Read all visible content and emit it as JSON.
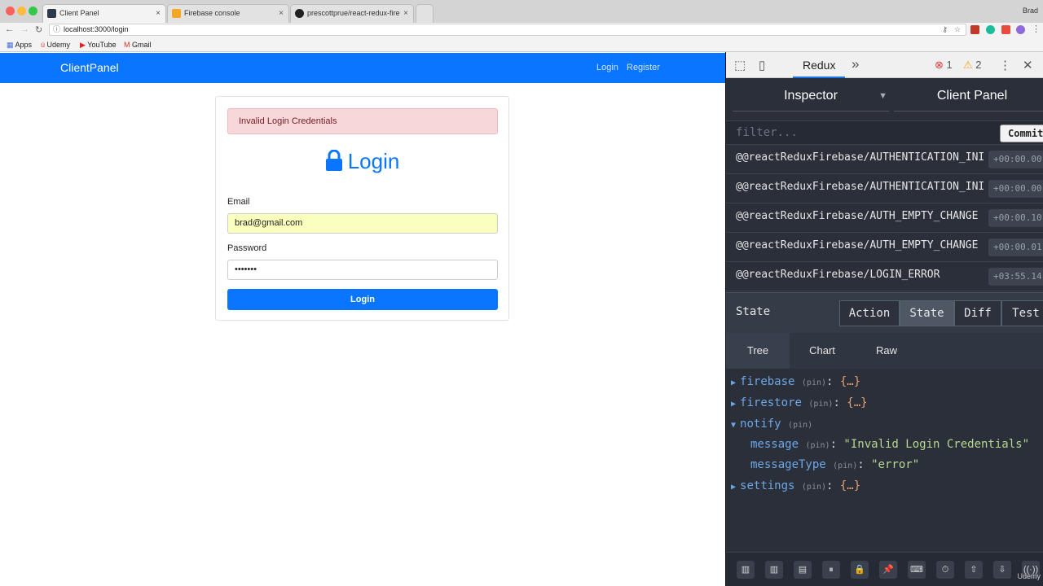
{
  "browser": {
    "user": "Brad",
    "tabs": [
      {
        "title": "Client Panel",
        "close": "×"
      },
      {
        "title": "Firebase console",
        "close": "×"
      },
      {
        "title": "prescottprue/react-redux-fire",
        "close": "×"
      }
    ],
    "url": "localhost:3000/login",
    "bookmarks": [
      "Apps",
      "Udemy",
      "YouTube",
      "Gmail"
    ]
  },
  "app": {
    "brand": "ClientPanel",
    "nav": {
      "login": "Login",
      "register": "Register"
    },
    "alert": "Invalid Login Credentials",
    "heading": "Login",
    "email_label": "Email",
    "email_value": "brad@gmail.com",
    "password_label": "Password",
    "password_value": "•••••••",
    "submit": "Login"
  },
  "devtools": {
    "tab": "Redux",
    "more": "»",
    "errors": "1",
    "warnings": "2",
    "inspector": "Inspector",
    "instance": "Client Panel",
    "filter_placeholder": "filter...",
    "commit": "Commit",
    "actions": [
      {
        "name": "@@reactReduxFirebase/AUTHENTICATION_INIT_STARTED",
        "time": "+00:00.00"
      },
      {
        "name": "@@reactReduxFirebase/AUTHENTICATION_INIT_FINISHED",
        "time": "+00:00.00"
      },
      {
        "name": "@@reactReduxFirebase/AUTH_EMPTY_CHANGE",
        "time": "+00:00.10"
      },
      {
        "name": "@@reactReduxFirebase/AUTH_EMPTY_CHANGE",
        "time": "+00:00.01"
      },
      {
        "name": "@@reactReduxFirebase/LOGIN_ERROR",
        "time": "+03:55.14"
      }
    ],
    "state_title": "State",
    "modes": [
      "Action",
      "State",
      "Diff",
      "Test"
    ],
    "subtabs": [
      "Tree",
      "Chart",
      "Raw"
    ],
    "tree": {
      "firebase": "firebase",
      "firestore": "firestore",
      "notify": "notify",
      "message_key": "message",
      "message_val": "\"Invalid Login Credentials\"",
      "messageType_key": "messageType",
      "messageType_val": "\"error\"",
      "settings": "settings",
      "pin": "(pin)",
      "collapsed": "{…}"
    },
    "watermark": "Udemy"
  }
}
